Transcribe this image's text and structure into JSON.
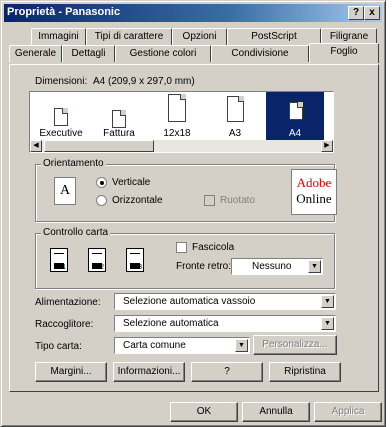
{
  "window": {
    "title": "Proprietà - Panasonic",
    "help_btn": "?",
    "close_btn": "x"
  },
  "tabs_row1": [
    "Immagini",
    "Tipi di carattere",
    "Opzioni",
    "PostScript",
    "Filigrane"
  ],
  "tabs_row2": [
    "Generale",
    "Dettagli",
    "Gestione colori",
    "Condivisione",
    "Foglio"
  ],
  "active_tab": "Foglio",
  "dimensions": {
    "label": "Dimensioni:",
    "value": "A4 (209,9 x 297,0 mm)"
  },
  "paper_sizes": [
    "Executive",
    "Fattura",
    "12x18",
    "A3",
    "A4"
  ],
  "selected_paper": "A4",
  "orientation": {
    "title": "Orientamento",
    "vertical": "Verticale",
    "horizontal": "Orizzontale",
    "rotated": "Ruotato",
    "selected": "Verticale",
    "icon_letter": "A"
  },
  "adobe": {
    "line1": "Adobe",
    "line2": "Online"
  },
  "paper_control": {
    "title": "Controllo carta",
    "collate": "Fascicola",
    "duplex_label": "Fronte retro:",
    "duplex_value": "Nessuno"
  },
  "feed": {
    "label": "Alimentazione:",
    "value": "Selezione automatica vassoio"
  },
  "output": {
    "label": "Raccoglitore:",
    "value": "Selezione automatica"
  },
  "paper_type": {
    "label": "Tipo carta:",
    "value": "Carta comune",
    "custom_btn": "Personalizza..."
  },
  "buttons_row": {
    "margins": "Margini...",
    "info": "Informazioni...",
    "help": "?",
    "restore": "Ripristina"
  },
  "dialog_buttons": {
    "ok": "OK",
    "cancel": "Annulla",
    "apply": "Applica"
  },
  "colors": {
    "title_start": "#0a246a",
    "title_end": "#a6caf0",
    "face": "#d4d0c8",
    "select": "#0a246a",
    "adobe_red": "#e00000"
  }
}
